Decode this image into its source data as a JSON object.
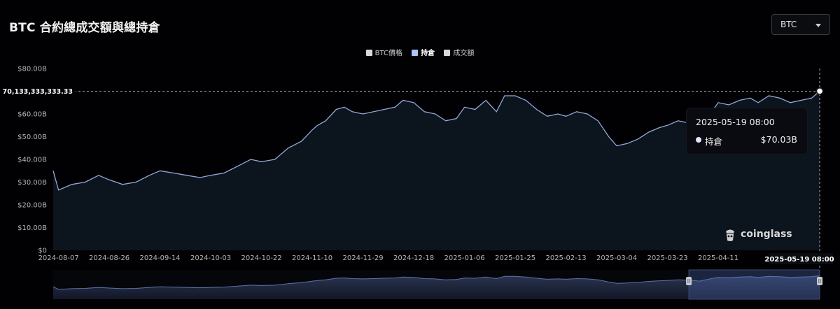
{
  "header": {
    "title": "BTC 合約總成交額與總持倉"
  },
  "selector": {
    "value": "BTC",
    "caret_icon": "chevron-down-icon"
  },
  "legend": [
    {
      "label": "BTC價格",
      "color": "#d9d9d9",
      "active": false
    },
    {
      "label": "持倉",
      "color": "#a9c4ff",
      "active": true
    },
    {
      "label": "成交額",
      "color": "#d9d9d9",
      "active": false
    }
  ],
  "crosshair": {
    "y_value_label": "70,133,333,333.33",
    "x_value_label": "2025-05-19 08:00"
  },
  "tooltip": {
    "date": "2025-05-19 08:00",
    "series_name": "持倉",
    "value_label": "$70.03B"
  },
  "watermark": {
    "text": "coinglass",
    "icon": "coinglass-logo-icon"
  },
  "chart_data": {
    "type": "area",
    "series": [
      {
        "name": "持倉",
        "color": "#93a9d9",
        "x": [
          "2024-08-05",
          "2024-08-07",
          "2024-08-12",
          "2024-08-17",
          "2024-08-22",
          "2024-08-26",
          "2024-08-31",
          "2024-09-05",
          "2024-09-10",
          "2024-09-14",
          "2024-09-19",
          "2024-09-24",
          "2024-09-29",
          "2024-10-03",
          "2024-10-08",
          "2024-10-13",
          "2024-10-18",
          "2024-10-22",
          "2024-10-27",
          "2024-11-01",
          "2024-11-06",
          "2024-11-10",
          "2024-11-12",
          "2024-11-15",
          "2024-11-19",
          "2024-11-22",
          "2024-11-25",
          "2024-11-29",
          "2024-12-03",
          "2024-12-07",
          "2024-12-11",
          "2024-12-14",
          "2024-12-18",
          "2024-12-22",
          "2024-12-26",
          "2024-12-30",
          "2025-01-03",
          "2025-01-06",
          "2025-01-10",
          "2025-01-14",
          "2025-01-18",
          "2025-01-21",
          "2025-01-25",
          "2025-01-29",
          "2025-02-02",
          "2025-02-06",
          "2025-02-10",
          "2025-02-13",
          "2025-02-17",
          "2025-02-21",
          "2025-02-25",
          "2025-03-01",
          "2025-03-04",
          "2025-03-08",
          "2025-03-12",
          "2025-03-16",
          "2025-03-20",
          "2025-03-23",
          "2025-03-27",
          "2025-03-31",
          "2025-04-04",
          "2025-04-08",
          "2025-04-11",
          "2025-04-15",
          "2025-04-19",
          "2025-04-23",
          "2025-04-26",
          "2025-04-30",
          "2025-05-04",
          "2025-05-08",
          "2025-05-12",
          "2025-05-16",
          "2025-05-19"
        ],
        "y": [
          35,
          26.5,
          29,
          30,
          33,
          31,
          29,
          30,
          33,
          35,
          34,
          33,
          32,
          33,
          34,
          37,
          40,
          39,
          40,
          45,
          48,
          53,
          55,
          57,
          62,
          63,
          61,
          60,
          61,
          62,
          63,
          66,
          65,
          61,
          60,
          57,
          58,
          63,
          62,
          66,
          61,
          68,
          68,
          66,
          62,
          59,
          60,
          59,
          61,
          60,
          57,
          50,
          46,
          47,
          49,
          52,
          54,
          55,
          57,
          56,
          53,
          60,
          65,
          64,
          66,
          67,
          65,
          68,
          67,
          65,
          66,
          67,
          70.03
        ]
      }
    ],
    "y_ticks": [
      "$0",
      "$10.00B",
      "$20.00B",
      "$30.00B",
      "$40.00B",
      "$50.00B",
      "$60.00B",
      "$70.00B",
      "$80.00B"
    ],
    "x_ticks": [
      "2024-08-07",
      "2024-08-26",
      "2024-09-14",
      "2024-10-03",
      "2024-10-22",
      "2024-11-10",
      "2024-11-29",
      "2024-12-18",
      "2025-01-06",
      "2025-01-25",
      "2025-02-13",
      "2025-03-04",
      "2025-03-23",
      "2025-04-11"
    ],
    "ylim": [
      0,
      80
    ],
    "ylabel": "",
    "xlabel": "",
    "grid": false,
    "legend_position": "top-center",
    "navigator": {
      "window_start": "2025-03-31",
      "window_end": "2025-05-19"
    }
  }
}
